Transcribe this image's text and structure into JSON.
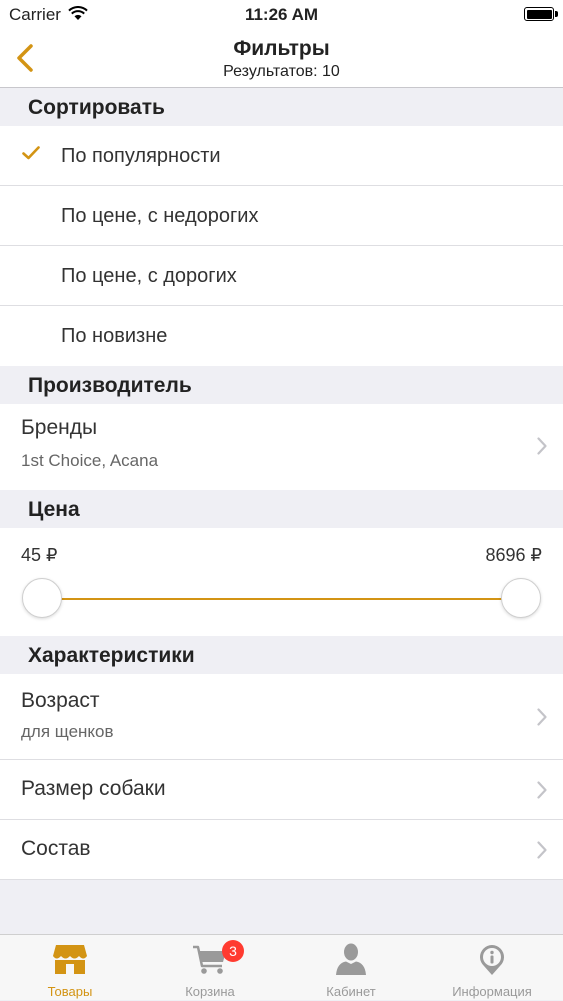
{
  "status_bar": {
    "carrier": "Carrier",
    "time": "11:26 AM"
  },
  "nav": {
    "title": "Фильтры",
    "subtitle": "Результатов: 10"
  },
  "sort": {
    "header": "Сортировать",
    "options": [
      {
        "label": "По популярности",
        "selected": true
      },
      {
        "label": "По цене, с недорогих",
        "selected": false
      },
      {
        "label": "По цене, с дорогих",
        "selected": false
      },
      {
        "label": "По новизне",
        "selected": false
      }
    ]
  },
  "manufacturer": {
    "header": "Производитель",
    "brands": {
      "label": "Бренды",
      "value": "1st Choice, Acana"
    }
  },
  "price": {
    "header": "Цена",
    "min_label": "45 ₽",
    "max_label": "8696 ₽",
    "range_min_fraction": 0.0,
    "range_max_fraction": 1.0
  },
  "characteristics": {
    "header": "Характеристики",
    "items": [
      {
        "label": "Возраст",
        "value": "для щенков"
      },
      {
        "label": "Размер собаки"
      },
      {
        "label": "Состав"
      }
    ]
  },
  "tabs": [
    {
      "label": "Товары",
      "icon": "store-icon",
      "active": true
    },
    {
      "label": "Корзина",
      "icon": "cart-icon",
      "badge": "3"
    },
    {
      "label": "Кабинет",
      "icon": "person-icon"
    },
    {
      "label": "Информация",
      "icon": "info-pin-icon"
    }
  ],
  "colors": {
    "accent": "#d39414",
    "badge": "#ff3b30",
    "inactive": "#9a9a9a"
  }
}
